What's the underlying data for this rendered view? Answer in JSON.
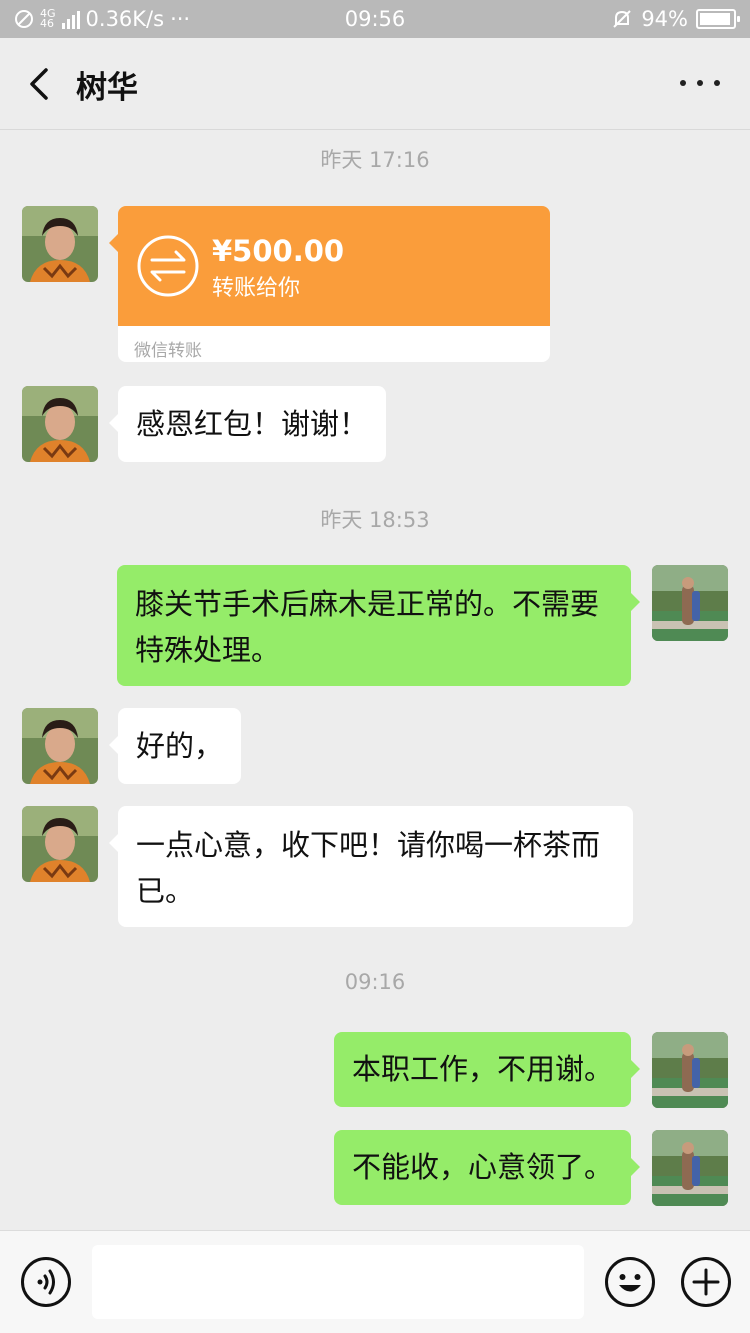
{
  "status_bar": {
    "network_speed": "0.36K/s",
    "more": "···",
    "time": "09:56",
    "battery": "94%"
  },
  "header": {
    "title": "树华"
  },
  "messages": {
    "ts1": "昨天 17:16",
    "transfer": {
      "amount": "¥500.00",
      "description": "转账给你",
      "footer": "微信转账"
    },
    "m1": "感恩红包！谢谢！",
    "ts2": "昨天 18:53",
    "m2": "膝关节手术后麻木是正常的。不需要特殊处理。",
    "m3": "好的，",
    "m4": "一点心意，收下吧！请你喝一杯茶而已。",
    "ts3": "09:16",
    "m5": "本职工作，不用谢。",
    "m6": "不能收，心意领了。"
  },
  "input_bar": {
    "placeholder": ""
  },
  "colors": {
    "outgoing_bubble": "#95ec69",
    "incoming_bubble": "#ffffff",
    "transfer_card": "#fa9d3b",
    "background": "#ededed"
  }
}
